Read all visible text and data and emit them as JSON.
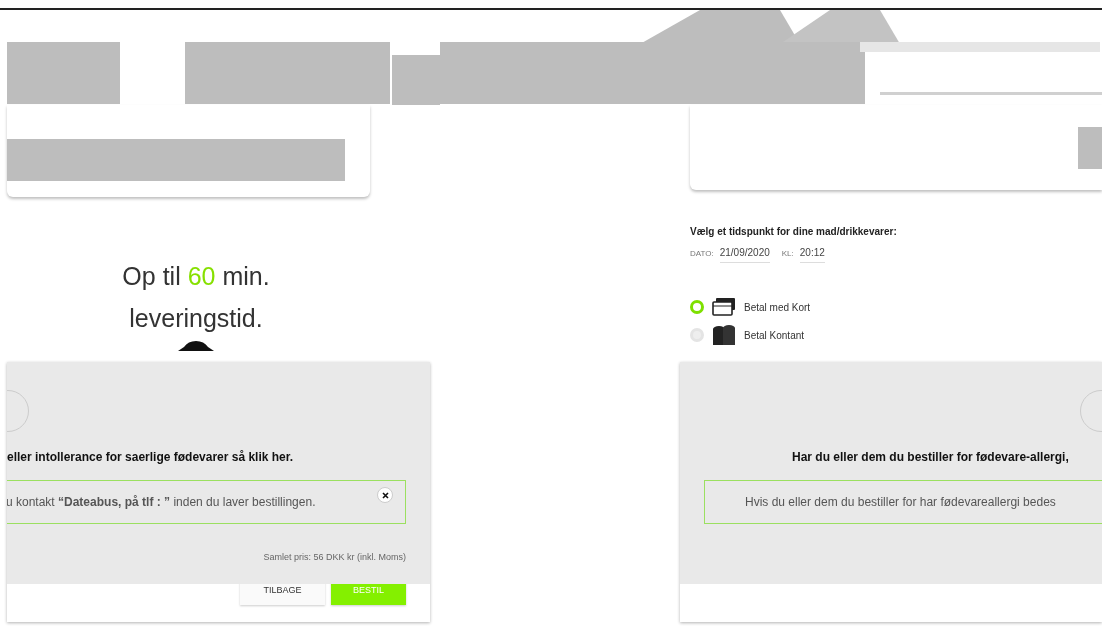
{
  "delivery": {
    "prefix": "Op til",
    "minutes": "60",
    "suffix": "min.",
    "line2": "leveringstid."
  },
  "schedule": {
    "heading": "Vælg et tidspunkt for dine mad/drikkevarer:",
    "date_label": "DATO:",
    "date": "21/09/2020",
    "time_label": "KL:",
    "time": "20:12"
  },
  "payment": [
    {
      "label": "Betal med Kort",
      "kind": "card",
      "selected": true
    },
    {
      "label": "Betal Kontant",
      "kind": "cash",
      "selected": false
    }
  ],
  "left_dialog": {
    "question": "eller intollerance for saerlige fødevarer så klik her.",
    "notice": "u kontakt **“Dateabus, på tlf : ”** inden du laver bestillingen.",
    "total": "Samlet pris: 56 DKK kr (inkl. Moms)",
    "buttons": [
      {
        "label": "TILBAGE",
        "kind": "secondary"
      },
      {
        "label": "BESTIL",
        "kind": "primary"
      }
    ]
  },
  "right_dialog": {
    "question": "Har du eller dem du bestiller for fødevare-allergi,",
    "notice": "Hvis du eller dem du bestiller for har fødevareallergi bedes"
  }
}
